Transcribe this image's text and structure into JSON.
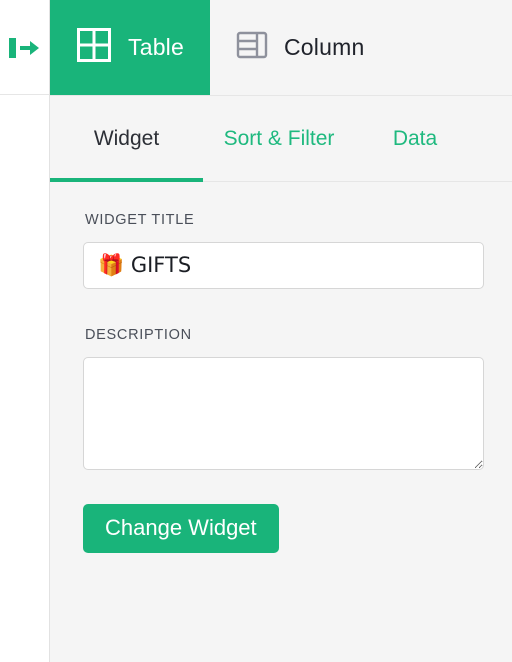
{
  "rail": {
    "toggle_icon": "sign-in-arrow-icon"
  },
  "top_tabs": [
    {
      "label": "Table",
      "icon": "grid-2x2-icon",
      "active": true
    },
    {
      "label": "Column",
      "icon": "table-column-icon",
      "active": false
    }
  ],
  "sub_tabs": [
    {
      "label": "Widget",
      "active": true
    },
    {
      "label": "Sort & Filter",
      "active": false
    },
    {
      "label": "Data",
      "active": false
    }
  ],
  "form": {
    "widget_title_label": "WIDGET TITLE",
    "widget_title_value": "🎁 GIFTS",
    "widget_title_placeholder": "",
    "description_label": "DESCRIPTION",
    "description_value": "",
    "description_placeholder": "",
    "submit_label": "Change Widget"
  },
  "colors": {
    "accent_green": "#19b47a",
    "link_green": "#1fb97f",
    "panel_bg": "#f5f5f5",
    "border": "#e6e6e6",
    "input_border": "#d6d6d6",
    "text_dark": "#20232b",
    "label_text": "#4a4f59"
  }
}
